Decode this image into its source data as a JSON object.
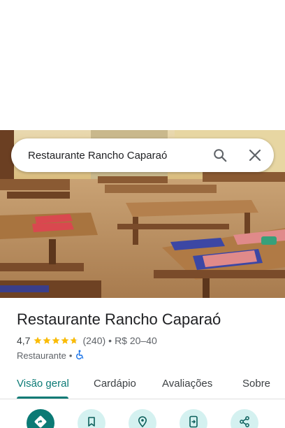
{
  "search": {
    "query": "Restaurante Rancho Caparaó",
    "search_icon": "search-icon",
    "close_icon": "close-icon"
  },
  "place": {
    "name": "Restaurante Rancho Caparaó",
    "rating_value": "4,7",
    "rating_stars": 4.7,
    "review_count": "(240)",
    "price": "R$ 20–40",
    "category": "Restaurante",
    "accessibility_icon": "wheelchair-icon"
  },
  "tabs": [
    {
      "label": "Visão geral",
      "active": true
    },
    {
      "label": "Cardápio",
      "active": false
    },
    {
      "label": "Avaliações",
      "active": false
    },
    {
      "label": "Sobre",
      "active": false
    }
  ],
  "actions": [
    {
      "icon": "directions-icon"
    },
    {
      "icon": "bookmark-icon"
    },
    {
      "icon": "location-pin-icon"
    },
    {
      "icon": "send-to-phone-icon"
    },
    {
      "icon": "share-icon"
    }
  ],
  "colors": {
    "accent": "#0b7a75",
    "action_bg": "#d4f1f0",
    "star": "#fbbc04",
    "accessibility": "#1a73e8"
  }
}
